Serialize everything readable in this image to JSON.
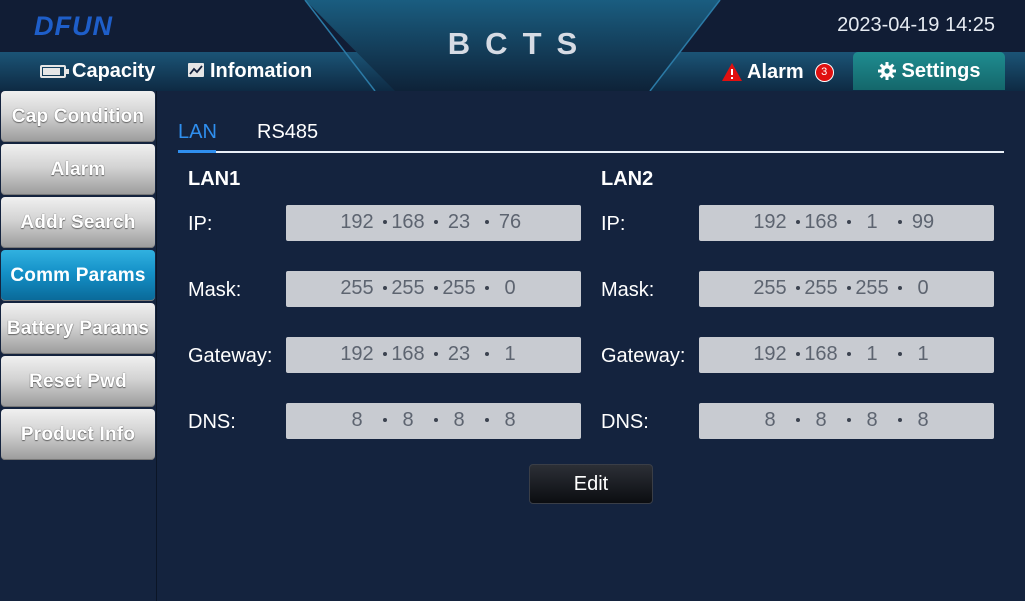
{
  "header": {
    "logo_text": "DFUN",
    "app_title": "BCTS",
    "datetime": "2023-04-19 14:25",
    "tabs": [
      {
        "label": "Capacity",
        "icon": "battery-icon"
      },
      {
        "label": "Infomation",
        "icon": "chart-icon"
      }
    ],
    "alarm": {
      "label": "Alarm",
      "count": "3",
      "icon": "warning-icon",
      "icon_color": "#e01010"
    },
    "settings": {
      "label": "Settings",
      "icon": "gear-icon",
      "color": "#1a7f83"
    }
  },
  "sidebar": {
    "active_color": "#1a9ad3",
    "items": [
      {
        "label": "Cap Condition",
        "active": false
      },
      {
        "label": "Alarm",
        "active": false
      },
      {
        "label": "Addr Search",
        "active": false
      },
      {
        "label": "Comm Params",
        "active": true
      },
      {
        "label": "Battery Params",
        "active": false
      },
      {
        "label": "Reset Pwd",
        "active": false
      },
      {
        "label": "Product Info",
        "active": false
      }
    ]
  },
  "main": {
    "sub_tabs": [
      {
        "label": "LAN",
        "active": true
      },
      {
        "label": "RS485",
        "active": false
      }
    ],
    "lan1": {
      "title": "LAN1",
      "ip_label": "IP:",
      "ip": [
        "192",
        "168",
        "23",
        "76"
      ],
      "mask_label": "Mask:",
      "mask": [
        "255",
        "255",
        "255",
        "0"
      ],
      "gateway_label": "Gateway:",
      "gateway": [
        "192",
        "168",
        "23",
        "1"
      ],
      "dns_label": "DNS:",
      "dns": [
        "8",
        "8",
        "8",
        "8"
      ]
    },
    "lan2": {
      "title": "LAN2",
      "ip_label": "IP:",
      "ip": [
        "192",
        "168",
        "1",
        "99"
      ],
      "mask_label": "Mask:",
      "mask": [
        "255",
        "255",
        "255",
        "0"
      ],
      "gateway_label": "Gateway:",
      "gateway": [
        "192",
        "168",
        "1",
        "1"
      ],
      "dns_label": "DNS:",
      "dns": [
        "8",
        "8",
        "8",
        "8"
      ]
    },
    "edit_label": "Edit"
  }
}
